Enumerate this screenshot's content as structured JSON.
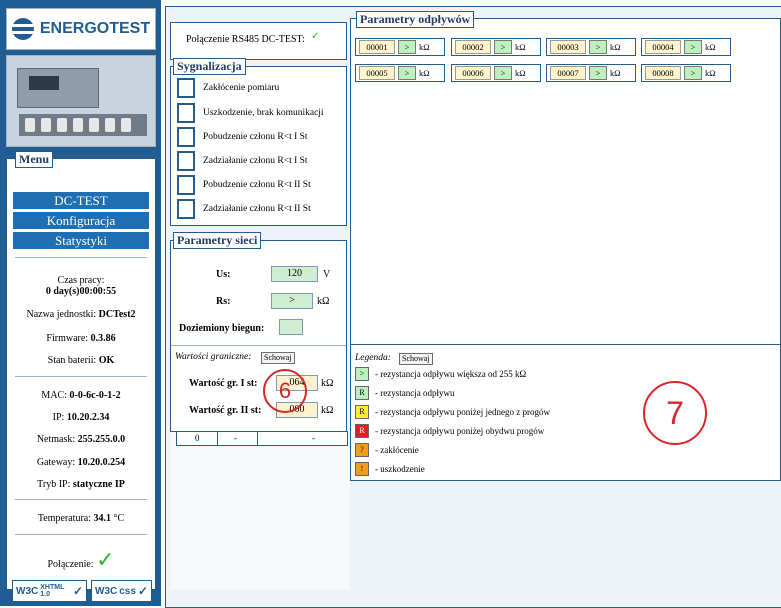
{
  "logo": {
    "text": "ENERGOTEST"
  },
  "menu": {
    "title": "Menu",
    "nav": [
      "DC-TEST",
      "Konfiguracja",
      "Statystyki"
    ],
    "uptime_label": "Czas pracy:",
    "uptime_value": "0 day(s)00:00:55",
    "unit_name_label": "Nazwa jednostki:",
    "unit_name_value": "DCTest2",
    "firmware_label": "Firmware:",
    "firmware_value": "0.3.86",
    "battery_label": "Stan baterii:",
    "battery_value": "OK",
    "mac_label": "MAC:",
    "mac_value": "0-0-6c-0-1-2",
    "ip_label": "IP:",
    "ip_value": "10.20.2.34",
    "netmask_label": "Netmask:",
    "netmask_value": "255.255.0.0",
    "gateway_label": "Gateway:",
    "gateway_value": "10.20.0.254",
    "ipmode_label": "Tryb IP:",
    "ipmode_value": "statyczne IP",
    "temp_label": "Temperatura:",
    "temp_value": "34.1",
    "temp_unit": "°C",
    "connection_label": "Połączenie:"
  },
  "badges": {
    "w3c": "W3C",
    "xhtml": "XHTML 1.0",
    "css": "css"
  },
  "connection": {
    "label": "Połączenie RS485 DC-TEST:",
    "status_icon": "check-icon"
  },
  "signals": {
    "title": "Sygnalizacja",
    "items": [
      "Zakłócenie pomiaru",
      "Uszkodzenie, brak komunikacji",
      "Pobudzenie członu  R<t I St",
      "Zadziałanie członu  R<t I St",
      "Pobudzenie członu  R<t II St",
      "Zadziałanie członu  R<t II St"
    ]
  },
  "params": {
    "title": "Parametry sieci",
    "us_label": "Us:",
    "us_value": "120",
    "us_unit": "V",
    "rs_label": "Rs:",
    "rs_value": ">",
    "rs_unit": "kΩ",
    "ground_label": "Doziemiony biegun:",
    "ground_value": "",
    "limits_label": "Wartości graniczne:",
    "hide_button": "Schowaj",
    "limit1_label": "Wartość gr. I st:",
    "limit1_value": "064",
    "limit1_unit": "kΩ",
    "limit2_label": "Wartość gr. II st:",
    "limit2_value": "000",
    "limit2_unit": "kΩ"
  },
  "partial_row": {
    "cell1": "0",
    "cell2": "-",
    "cell3": "-"
  },
  "outlets": {
    "title": "Parametry odpływów",
    "items": [
      {
        "id": "00001",
        "state": ">",
        "unit": "kΩ"
      },
      {
        "id": "00002",
        "state": ">",
        "unit": "kΩ"
      },
      {
        "id": "00003",
        "state": ">",
        "unit": "kΩ"
      },
      {
        "id": "00004",
        "state": ">",
        "unit": "kΩ"
      },
      {
        "id": "00005",
        "state": ">",
        "unit": "kΩ"
      },
      {
        "id": "00006",
        "state": ">",
        "unit": "kΩ"
      },
      {
        "id": "00007",
        "state": ">",
        "unit": "kΩ"
      },
      {
        "id": "00008",
        "state": ">",
        "unit": "kΩ"
      }
    ]
  },
  "legend": {
    "label": "Legenda:",
    "hide_button": "Schowaj",
    "items": [
      {
        "symbol": ">",
        "color": "#bdf0bd",
        "text": "- rezystancja odpływu większa od 255  kΩ"
      },
      {
        "symbol": "R",
        "color": "#bdf0bd",
        "text": "- rezystancja odpływu"
      },
      {
        "symbol": "R",
        "color": "#ffee33",
        "text": "- rezystancja odpływu poniżej jednego z progów"
      },
      {
        "symbol": "R",
        "color": "#e02020",
        "text": "- rezystancja odpływu poniżej obydwu progów"
      },
      {
        "symbol": "?",
        "color": "#f39a1f",
        "text": "- zakłócenie"
      },
      {
        "symbol": "!",
        "color": "#f39a1f",
        "text": "- uszkodzenie"
      }
    ]
  },
  "annotations": {
    "six": "6",
    "seven": "7"
  }
}
